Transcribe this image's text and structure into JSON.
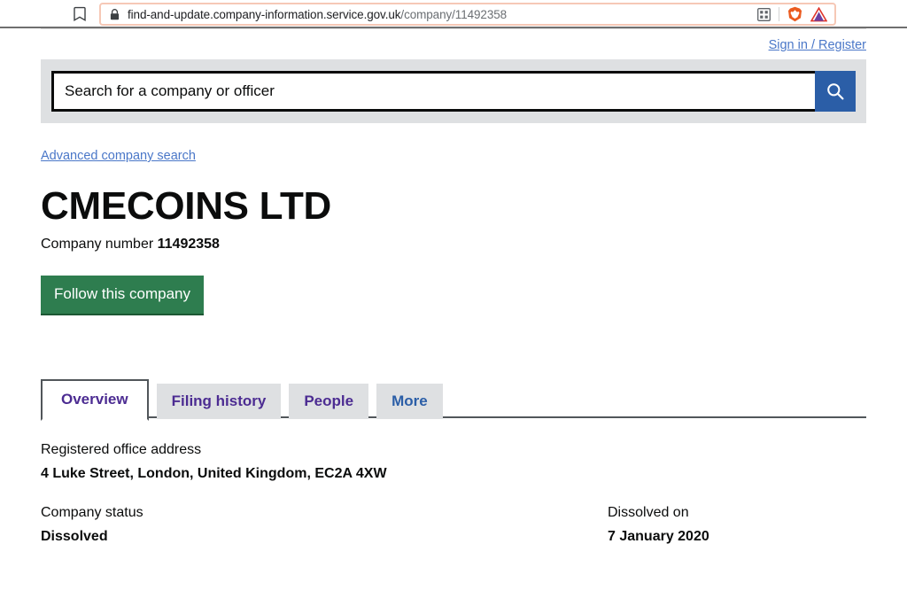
{
  "browser": {
    "bookmark_icon": "bookmark-icon",
    "lock_icon": "lock-icon",
    "url_domain": "find-and-update.company-information.service.gov.uk",
    "url_path": "/company/11492358",
    "url_full": "find-and-update.company-information.service.gov.uk/company/11492358",
    "qr_icon": "qr-code-icon",
    "brave_icon": "brave-shield-icon",
    "extension_icon": "extension-triangle-icon"
  },
  "header": {
    "signin_label": "Sign in / Register"
  },
  "search": {
    "placeholder": "Search for a company or officer",
    "value": "",
    "button_icon": "search-icon",
    "advanced_label": "Advanced company search"
  },
  "company": {
    "name": "CMECOINS LTD",
    "number_label": "Company number",
    "number": "11492358",
    "follow_label": "Follow this company"
  },
  "tabs": [
    {
      "label": "Overview",
      "active": true,
      "color": "purple"
    },
    {
      "label": "Filing history",
      "active": false,
      "color": "purple"
    },
    {
      "label": "People",
      "active": false,
      "color": "purple"
    },
    {
      "label": "More",
      "active": false,
      "color": "blue"
    }
  ],
  "details": {
    "address_label": "Registered office address",
    "address_value": "4 Luke Street, London, United Kingdom, EC2A 4XW",
    "status_label": "Company status",
    "status_value": "Dissolved",
    "dissolved_label": "Dissolved on",
    "dissolved_value": "7 January 2020"
  },
  "colors": {
    "accent_green": "#2e7d4f",
    "accent_blue": "#2b5ea7",
    "link_blue": "#4a77c8",
    "tab_purple": "#4c2c92",
    "band_grey": "#dee0e2"
  }
}
